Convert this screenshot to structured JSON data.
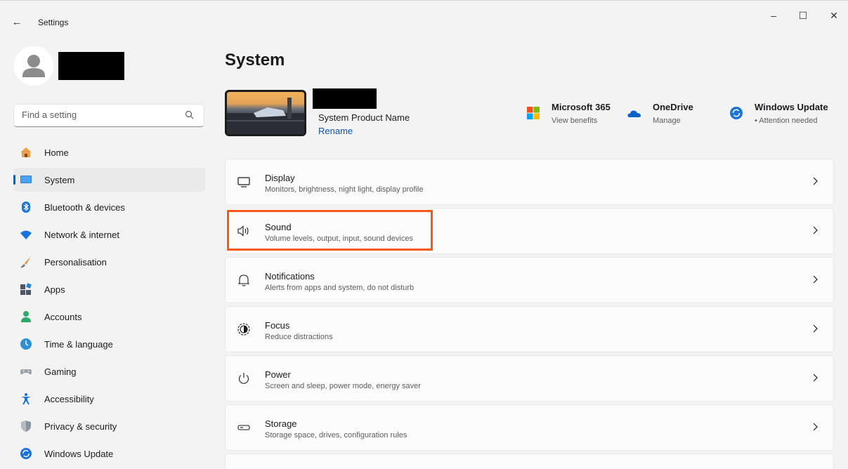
{
  "window": {
    "back_glyph": "←",
    "title": "Settings",
    "minimize_glyph": "–",
    "maximize_glyph": "☐",
    "close_glyph": "✕"
  },
  "sidebar": {
    "search_placeholder": "Find a setting",
    "items": [
      {
        "label": "Home",
        "icon": "home-icon",
        "selected": false
      },
      {
        "label": "System",
        "icon": "system-icon",
        "selected": true
      },
      {
        "label": "Bluetooth & devices",
        "icon": "bluetooth-icon",
        "selected": false
      },
      {
        "label": "Network & internet",
        "icon": "wifi-icon",
        "selected": false
      },
      {
        "label": "Personalisation",
        "icon": "brush-icon",
        "selected": false
      },
      {
        "label": "Apps",
        "icon": "apps-icon",
        "selected": false
      },
      {
        "label": "Accounts",
        "icon": "accounts-icon",
        "selected": false
      },
      {
        "label": "Time & language",
        "icon": "time-language-icon",
        "selected": false
      },
      {
        "label": "Gaming",
        "icon": "gamepad-icon",
        "selected": false
      },
      {
        "label": "Accessibility",
        "icon": "accessibility-icon",
        "selected": false
      },
      {
        "label": "Privacy & security",
        "icon": "shield-icon",
        "selected": false
      },
      {
        "label": "Windows Update",
        "icon": "windows-update-icon",
        "selected": false
      }
    ]
  },
  "main": {
    "title": "System",
    "device": {
      "product_name": "System Product Name",
      "rename_label": "Rename"
    },
    "quick_links": [
      {
        "title": "Microsoft 365",
        "subtitle": "View benefits",
        "icon": "microsoft-logo-icon"
      },
      {
        "title": "OneDrive",
        "subtitle": "Manage",
        "icon": "onedrive-cloud-icon"
      },
      {
        "title": "Windows Update",
        "subtitle": "• Attention needed",
        "icon": "windows-update-icon"
      }
    ],
    "cards": [
      {
        "title": "Display",
        "subtitle": "Monitors, brightness, night light, display profile",
        "icon": "monitor-icon"
      },
      {
        "title": "Sound",
        "subtitle": "Volume levels, output, input, sound devices",
        "icon": "speaker-icon"
      },
      {
        "title": "Notifications",
        "subtitle": "Alerts from apps and system, do not disturb",
        "icon": "bell-icon"
      },
      {
        "title": "Focus",
        "subtitle": "Reduce distractions",
        "icon": "focus-icon"
      },
      {
        "title": "Power",
        "subtitle": "Screen and sleep, power mode, energy saver",
        "icon": "power-icon"
      },
      {
        "title": "Storage",
        "subtitle": "Storage space, drives, configuration rules",
        "icon": "storage-icon"
      }
    ]
  },
  "colors": {
    "accent": "#0067c0",
    "highlight": "#f25a1b",
    "link": "#0a58b8"
  }
}
